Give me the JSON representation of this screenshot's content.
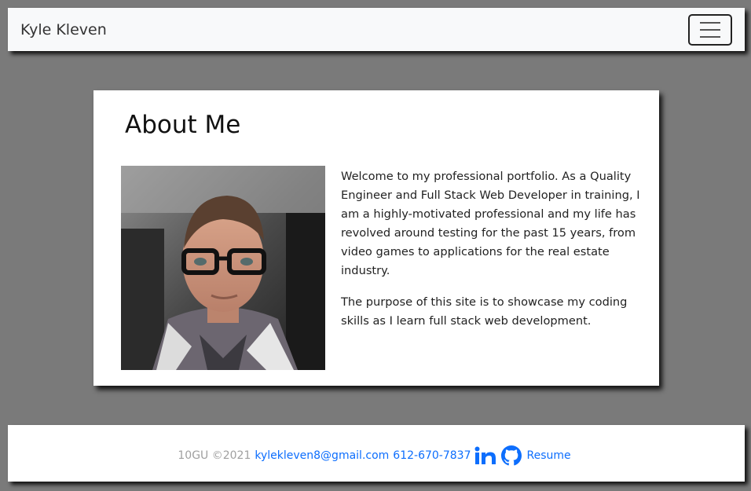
{
  "navbar": {
    "brand": "Kyle Kleven",
    "toggle_icon": "hamburger-menu-icon"
  },
  "about": {
    "title": "About Me",
    "photo_icon": "profile-photo",
    "paragraphs": [
      "Welcome to my professional portfolio. As a Quality Engineer and Full Stack Web Developer in training, I am a highly-motivated professional and my life has revolved around testing for the past 15 years, from video games to applications for the real estate industry.",
      "The purpose of this site is to showcase my coding skills as I learn full stack web development."
    ]
  },
  "footer": {
    "copyright": "10GU ©2021",
    "email": "kylekleven8@gmail.com",
    "phone": "612-670-7837",
    "linkedin_icon": "linkedin-icon",
    "github_icon": "github-icon",
    "resume": "Resume"
  },
  "colors": {
    "page_background": "#7a7a7a",
    "link": "#0d6efd",
    "muted": "#a0a0a0"
  }
}
